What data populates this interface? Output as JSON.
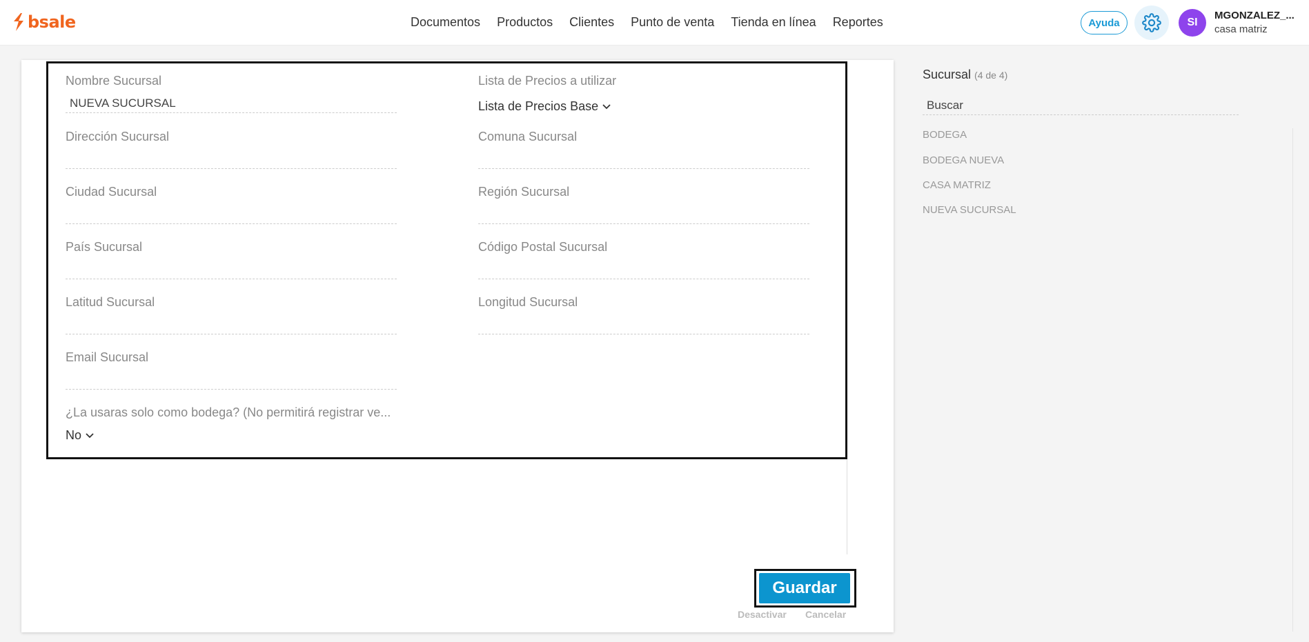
{
  "brand": {
    "name": "bsale",
    "color": "#f0651f"
  },
  "nav": [
    "Documentos",
    "Productos",
    "Clientes",
    "Punto de venta",
    "Tienda en línea",
    "Reportes"
  ],
  "header": {
    "help_label": "Ayuda",
    "settings_icon": "gear-icon",
    "avatar_initials": "SI",
    "user_name": "MGONZALEZ_...",
    "user_branch": "casa matriz"
  },
  "form": {
    "nombre": {
      "label": "Nombre Sucursal",
      "value": "NUEVA SUCURSAL"
    },
    "lista_precios": {
      "label": "Lista de Precios a utilizar",
      "value": "Lista de Precios Base"
    },
    "direccion": {
      "label": "Dirección Sucursal",
      "value": ""
    },
    "comuna": {
      "label": "Comuna Sucursal",
      "value": ""
    },
    "ciudad": {
      "label": "Ciudad Sucursal",
      "value": ""
    },
    "region": {
      "label": "Región Sucursal",
      "value": ""
    },
    "pais": {
      "label": "País Sucursal",
      "value": ""
    },
    "codigo_postal": {
      "label": "Código Postal Sucursal",
      "value": ""
    },
    "latitud": {
      "label": "Latitud Sucursal",
      "value": ""
    },
    "longitud": {
      "label": "Longitud Sucursal",
      "value": ""
    },
    "email": {
      "label": "Email Sucursal",
      "value": ""
    },
    "solo_bodega": {
      "label": "¿La usaras solo como bodega? (No permitirá registrar ve...",
      "value": "No"
    }
  },
  "actions": {
    "save": "Guardar",
    "deactivate": "Desactivar",
    "cancel": "Cancelar"
  },
  "sidebar": {
    "title": "Sucursal",
    "count": "(4 de 4)",
    "search_placeholder": "Buscar",
    "items": [
      "BODEGA",
      "BODEGA NUEVA",
      "CASA MATRIZ",
      "NUEVA SUCURSAL"
    ]
  }
}
